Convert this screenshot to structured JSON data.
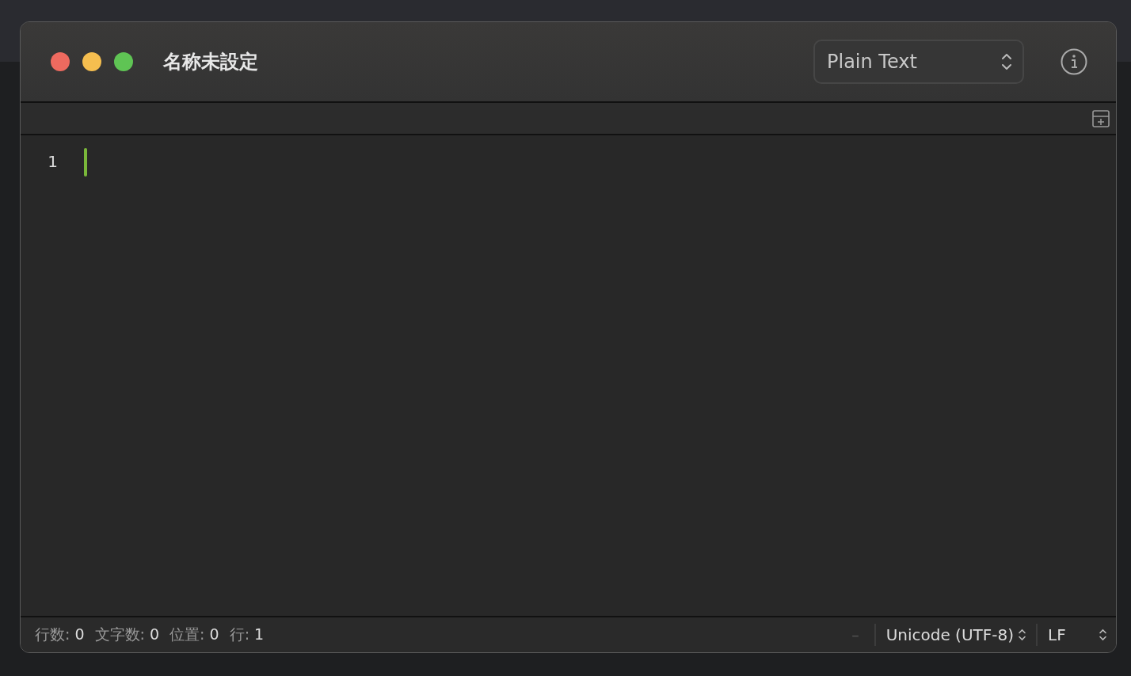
{
  "window": {
    "title": "名称未設定"
  },
  "syntax_menu": {
    "value": "Plain Text"
  },
  "editor": {
    "line_numbers": [
      "1"
    ]
  },
  "status_bar": {
    "stats": [
      {
        "label": "行数:",
        "value": "0"
      },
      {
        "label": "文字数:",
        "value": "0"
      },
      {
        "label": "位置:",
        "value": "0"
      },
      {
        "label": "行:",
        "value": "1"
      }
    ],
    "indicator": "–",
    "encoding": "Unicode (UTF-8)",
    "line_ending": "LF"
  }
}
